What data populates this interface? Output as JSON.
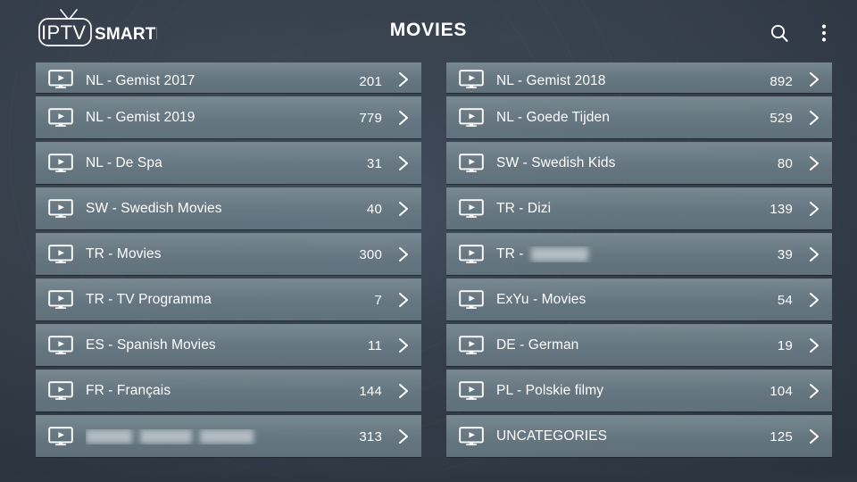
{
  "app": {
    "logo_primary": "IPTV",
    "logo_secondary": "SMARTERS",
    "title": "MOVIES"
  },
  "header": {
    "search_icon": "search-icon",
    "overflow_icon": "more-vertical-icon"
  },
  "colors": {
    "background_top": "#3b4654",
    "background_bottom": "#2f3843",
    "row_fill": "#6d7f88",
    "text": "#ffffff"
  },
  "list": {
    "item_icon": "tv-play-icon",
    "chevron_icon": "chevron-right-icon",
    "left_column": [
      {
        "label": "NL - Gemist 2017",
        "count": "201",
        "redacted": false,
        "partial": true
      },
      {
        "label": "NL - Gemist 2019",
        "count": "779",
        "redacted": false
      },
      {
        "label": "NL - De Spa",
        "count": "31",
        "redacted": false
      },
      {
        "label": "SW - Swedish Movies",
        "count": "40",
        "redacted": false
      },
      {
        "label": "TR - Movies",
        "count": "300",
        "redacted": false
      },
      {
        "label": "TR - TV Programma",
        "count": "7",
        "redacted": false
      },
      {
        "label": "ES - Spanish Movies",
        "count": "11",
        "redacted": false
      },
      {
        "label": "FR - Français",
        "count": "144",
        "redacted": false
      },
      {
        "label": "",
        "count": "313",
        "redacted": true
      }
    ],
    "right_column": [
      {
        "label": "NL - Gemist 2018",
        "count": "892",
        "redacted": false,
        "partial": true
      },
      {
        "label": "NL - Goede Tijden",
        "count": "529",
        "redacted": false
      },
      {
        "label": "SW - Swedish Kids",
        "count": "80",
        "redacted": false
      },
      {
        "label": "TR - Dizi",
        "count": "139",
        "redacted": false
      },
      {
        "label": "TR - ",
        "count": "39",
        "redacted": "partial"
      },
      {
        "label": "ExYu - Movies",
        "count": "54",
        "redacted": false
      },
      {
        "label": "DE - German",
        "count": "19",
        "redacted": false
      },
      {
        "label": "PL - Polskie filmy",
        "count": "104",
        "redacted": false
      },
      {
        "label": "UNCATEGORIES",
        "count": "125",
        "redacted": false
      }
    ]
  }
}
